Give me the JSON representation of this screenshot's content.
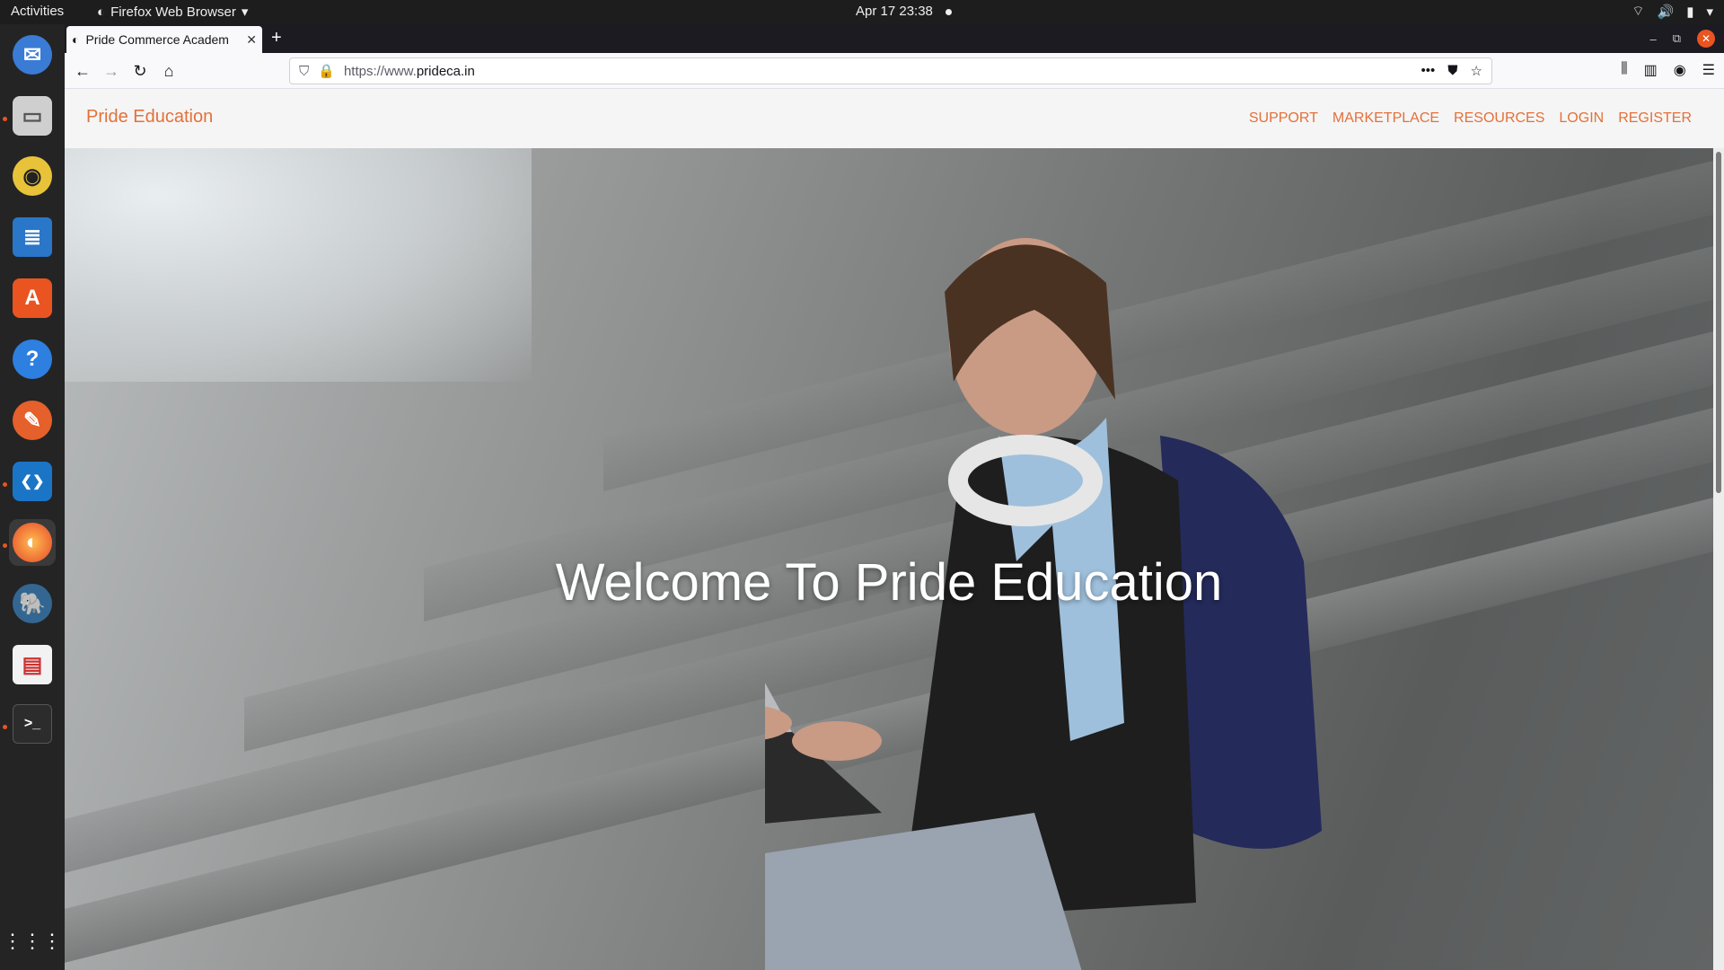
{
  "topbar": {
    "activities": "Activities",
    "app_menu": "Firefox Web Browser",
    "clock": "Apr 17  23:38"
  },
  "dock": {
    "items": [
      {
        "name": "thunderbird-icon",
        "glyph": "✉"
      },
      {
        "name": "files-icon",
        "glyph": "▭"
      },
      {
        "name": "rhythmbox-icon",
        "glyph": "◉"
      },
      {
        "name": "writer-icon",
        "glyph": "≣"
      },
      {
        "name": "software-icon",
        "glyph": "A"
      },
      {
        "name": "help-icon",
        "glyph": "?"
      },
      {
        "name": "inkscape-icon",
        "glyph": "✎"
      },
      {
        "name": "vscode-icon",
        "glyph": "❮❯"
      },
      {
        "name": "firefox-icon",
        "glyph": "◐"
      },
      {
        "name": "postgres-icon",
        "glyph": "🐘"
      },
      {
        "name": "document-viewer-icon",
        "glyph": "▤"
      },
      {
        "name": "terminal-icon",
        "glyph": ">_"
      }
    ],
    "apps_glyph": "⋮⋮⋮"
  },
  "browser": {
    "tab_title": "Pride Commerce Academ",
    "url_prefix": "https://www.",
    "url_host": "prideca.in",
    "url_dots": "•••"
  },
  "site": {
    "brand": "Pride Education",
    "menu": [
      "SUPPORT",
      "MARKETPLACE",
      "RESOURCES",
      "LOGIN",
      "REGISTER"
    ],
    "hero_title": "Welcome To Pride Education"
  },
  "colors": {
    "brand": "#e3713a",
    "accent_ubuntu": "#e95420"
  }
}
